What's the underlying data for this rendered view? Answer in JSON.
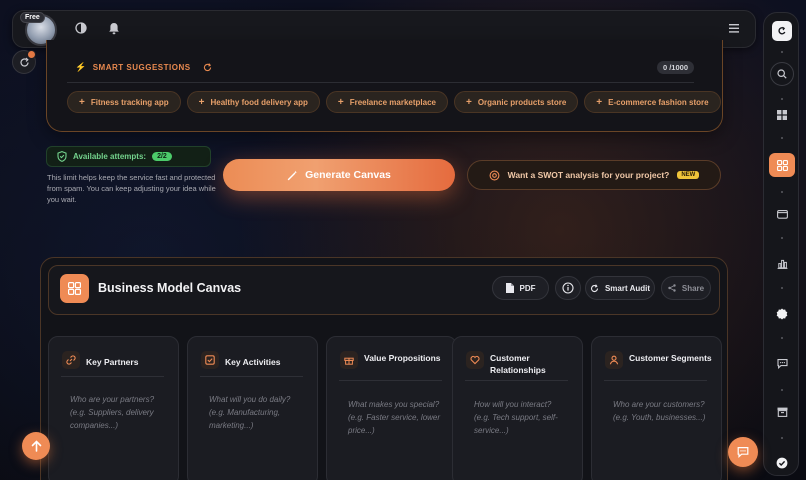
{
  "topbar": {
    "free_badge": "Free"
  },
  "suggestions": {
    "heading": "SMART SUGGESTIONS",
    "counter": "0 /1000",
    "chips": [
      "Fitness tracking app",
      "Healthy food delivery app",
      "Freelance marketplace",
      "Organic products store",
      "E-commerce fashion store"
    ]
  },
  "attempts": {
    "label": "Available attempts:",
    "value": "2/2",
    "note": "This limit helps keep the service fast and protected from spam. You can keep adjusting your idea while you wait."
  },
  "actions": {
    "generate": "Generate Canvas",
    "swot": "Want a SWOT analysis for your project?",
    "swot_badge": "NEW"
  },
  "bmc": {
    "title": "Business Model Canvas",
    "pdf": "PDF",
    "smart_audit": "Smart Audit",
    "share": "Share",
    "cards": [
      {
        "title": "Key Partners",
        "placeholder": "Who are your partners? (e.g. Suppliers, delivery companies...)"
      },
      {
        "title": "Key Activities",
        "placeholder": "What will you do daily? (e.g. Manufacturing, marketing...)"
      },
      {
        "title": "Value Propositions",
        "placeholder": "What makes you special? (e.g. Faster service, lower price...)"
      },
      {
        "title": "Customer Relationships",
        "placeholder": "How will you interact? (e.g. Tech support, self-service...)"
      },
      {
        "title": "Customer Segments",
        "placeholder": "Who are your customers? (e.g. Youth, businesses...)"
      }
    ]
  },
  "colors": {
    "accent": "#ef8b55",
    "success": "#4ccb6a"
  }
}
